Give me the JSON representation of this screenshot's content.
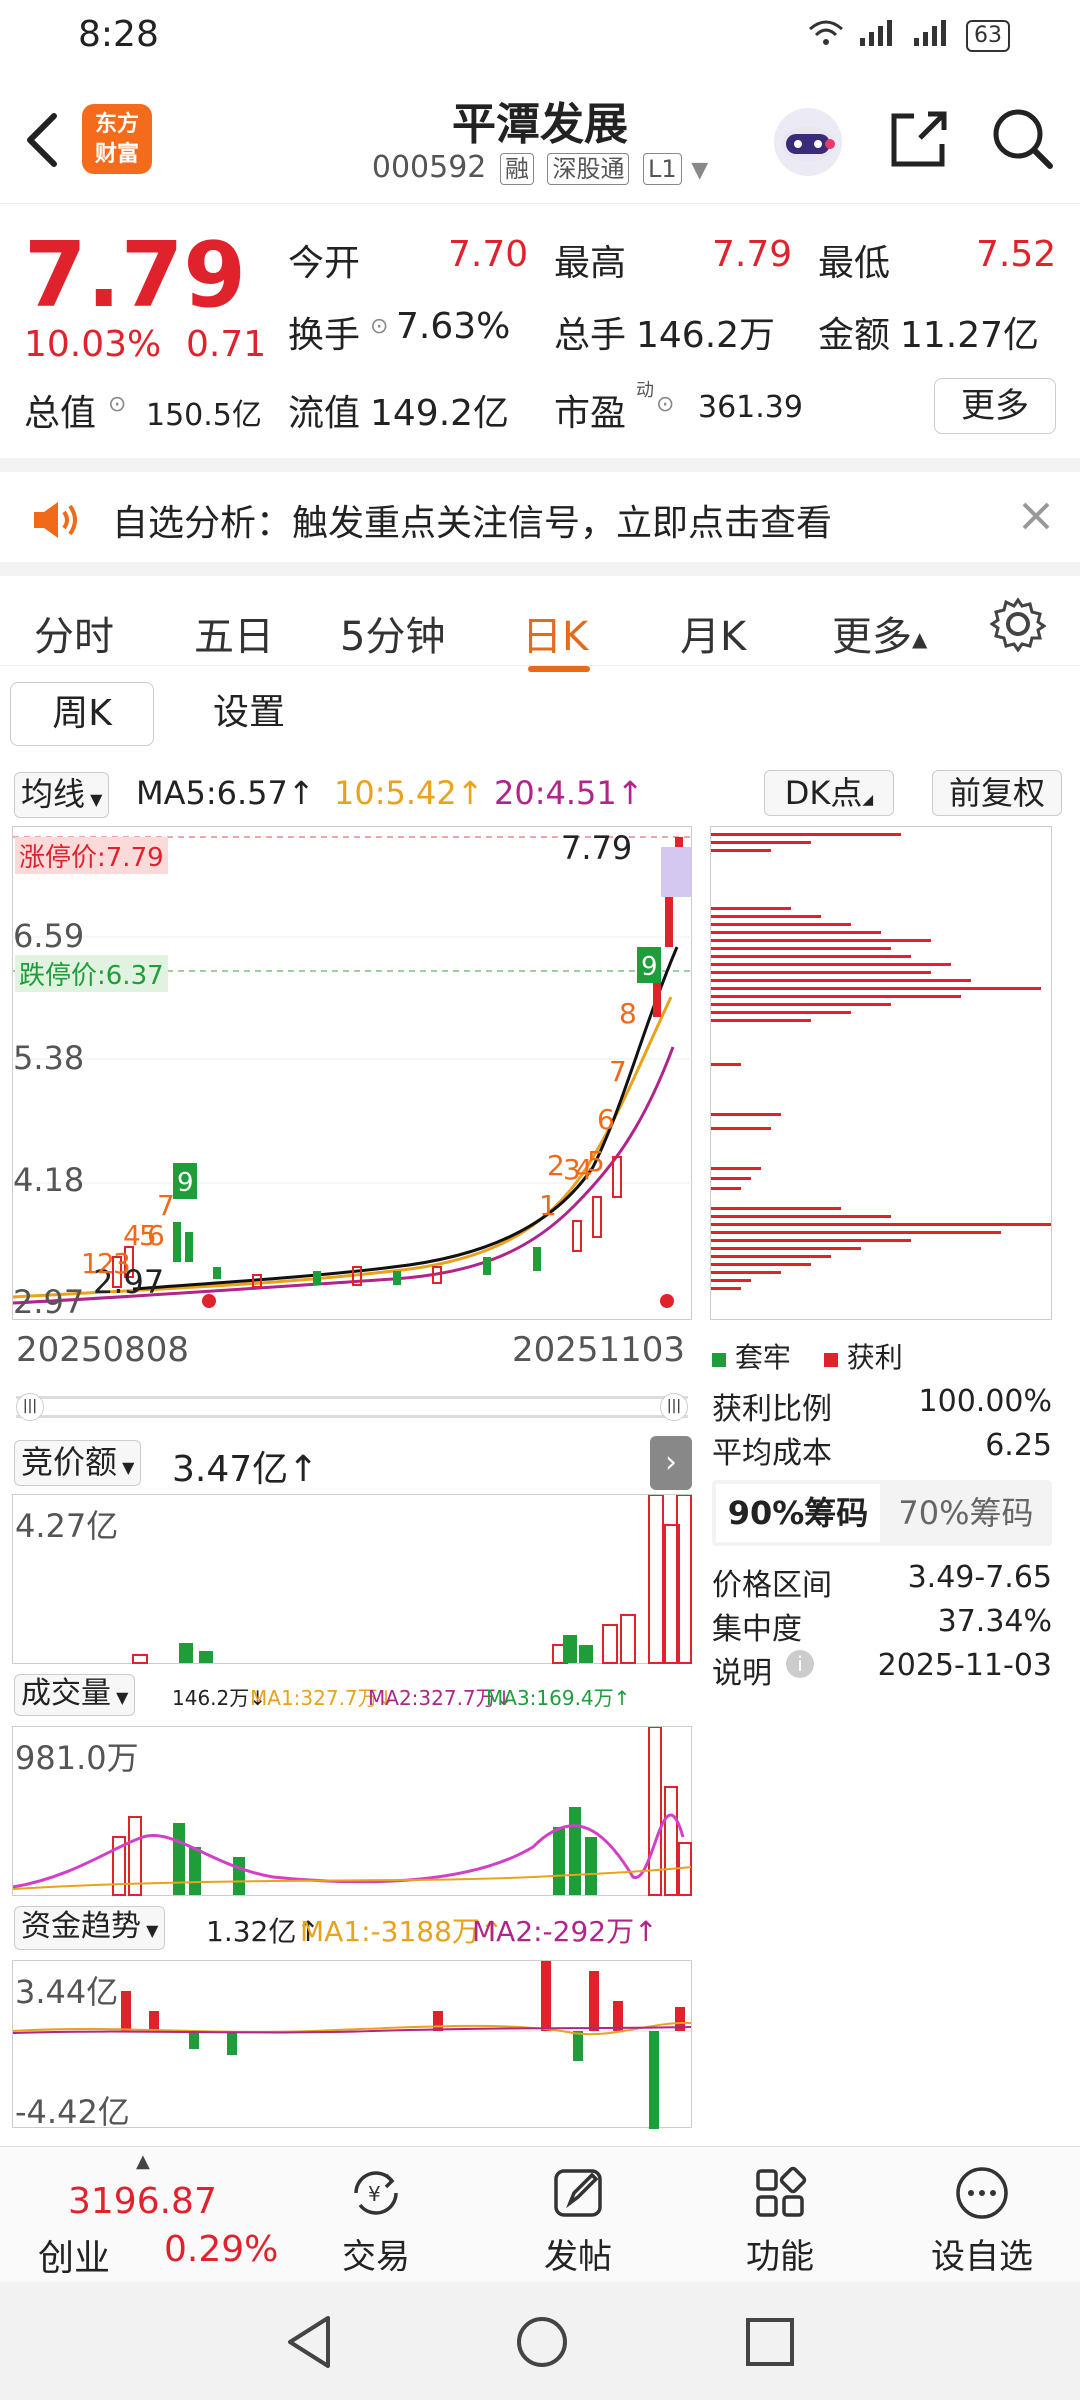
{
  "status_bar": {
    "time": "8:28",
    "network": "4G 4G",
    "battery": "63"
  },
  "header": {
    "logo_text_1": "东方",
    "logo_text_2": "财富",
    "title": "平潭发展",
    "code": "000592",
    "tags": [
      "融",
      "深股通",
      "L1"
    ]
  },
  "quote": {
    "price": "7.79",
    "change_pct": "10.03%",
    "change_amt": "0.71",
    "open_label": "今开",
    "open": "7.70",
    "high_label": "最高",
    "high": "7.79",
    "low_label": "最低",
    "low": "7.52",
    "turnover_label": "换手",
    "turnover": "7.63%",
    "volume_label": "总手",
    "volume": "146.2万",
    "amount_label": "金额",
    "amount": "11.27亿",
    "mktcap_label": "总值",
    "mktcap": "150.5亿",
    "float_label": "流值",
    "float": "149.2亿",
    "pe_label": "市盈",
    "pe_sup": "动",
    "pe": "361.39",
    "more": "更多"
  },
  "banner": {
    "text": "自选分析：触发重点关注信号，立即点击查看"
  },
  "tabs": {
    "items": [
      "分时",
      "五日",
      "5分钟",
      "日K",
      "月K",
      "更多"
    ],
    "active": "日K"
  },
  "subtabs": {
    "weekly": "周K",
    "settings": "设置"
  },
  "ma_bar": {
    "selector": "均线",
    "ma5": "MA5:6.57↑",
    "ma10": "10:5.42↑",
    "ma20": "20:4.51↑",
    "dk": "DK点",
    "adj": "前复权"
  },
  "kline": {
    "limit_up_label": "涨停价:7.79",
    "limit_down_label": "跌停价:6.37",
    "price_marker": "7.79",
    "y_labels": [
      "6.59",
      "5.38",
      "4.18",
      "2.97"
    ],
    "low_marker": "2.97",
    "start_date": "20250808",
    "end_date": "20251103",
    "signal_numbers": [
      "1",
      "2",
      "3",
      "4",
      "5",
      "6",
      "7",
      "8",
      "9"
    ]
  },
  "chips": {
    "legend_trapped": "套牢",
    "legend_profit": "获利",
    "profit_ratio_label": "获利比例",
    "profit_ratio": "100.00%",
    "avg_cost_label": "平均成本",
    "avg_cost": "6.25",
    "tab_90": "90%筹码",
    "tab_70": "70%筹码",
    "price_range_label": "价格区间",
    "price_range": "3.49-7.65",
    "concentration_label": "集中度",
    "concentration": "37.34%",
    "note_label": "说明",
    "note_date": "2025-11-03"
  },
  "auction": {
    "selector": "竞价额",
    "value": "3.47亿↑",
    "ymax": "4.27亿"
  },
  "volume": {
    "selector": "成交量",
    "value": "146.2万↓",
    "ma1": "MA1:327.7万↓",
    "ma2": "MA2:327.7万↓",
    "ma3": "MA3:169.4万↑",
    "ymax": "981.0万"
  },
  "fund": {
    "selector": "资金趋势",
    "value": "1.32亿↑",
    "ma1": "MA1:-3188万↑",
    "ma2": "MA2:-292万↑",
    "ymax": "3.44亿",
    "ymin": "-4.42亿"
  },
  "bottom_nav": {
    "index_value": "3196.87",
    "index_name": "创业",
    "index_pct": "0.29%",
    "trade": "交易",
    "post": "发帖",
    "functions": "功能",
    "add_watch": "设自选"
  },
  "colors": {
    "up": "#e0222c",
    "down": "#1f9d3a",
    "accent": "#e66a1c",
    "ma5": "#111111",
    "ma10": "#e8a21c",
    "ma20": "#b0248c"
  }
}
